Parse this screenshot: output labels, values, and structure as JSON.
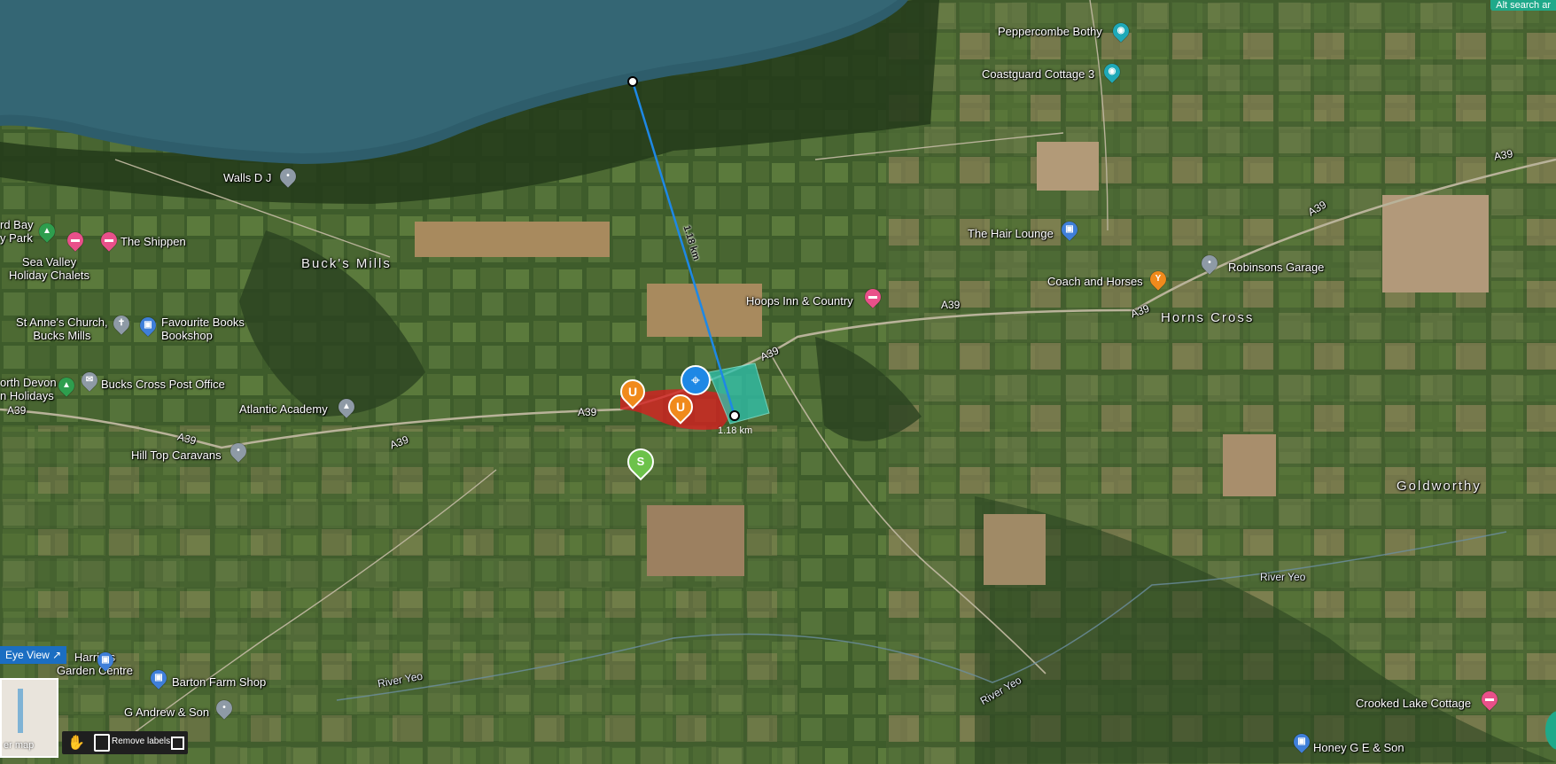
{
  "map": {
    "place_labels": [
      {
        "id": "peppercombe-bothy",
        "text": "Peppercombe Bothy",
        "icon": "camera-icon"
      },
      {
        "id": "coastguard-cottage",
        "text": "Coastguard Cottage 3",
        "icon": "camera-icon"
      },
      {
        "id": "walls-dj",
        "text": "Walls D J",
        "icon": "pin-icon"
      },
      {
        "id": "bay-park",
        "text": "rd Bay\ny Park",
        "icon": "campground-icon"
      },
      {
        "id": "the-shippen",
        "text": "The Shippen",
        "icon": "bed-icon"
      },
      {
        "id": "sea-valley",
        "text": "Sea Valley\nHoliday Chalets",
        "icon": "bed-icon"
      },
      {
        "id": "st-annes",
        "text": "St Anne's Church,\nBucks Mills",
        "icon": "cross-icon"
      },
      {
        "id": "favourite-books",
        "text": "Favourite Books\nBookshop",
        "icon": "shopping-bag-icon"
      },
      {
        "id": "north-devon",
        "text": "orth Devon\nn Holidays",
        "icon": "campground-icon"
      },
      {
        "id": "bucks-cross-po",
        "text": "Bucks Cross Post Office",
        "icon": "mail-icon"
      },
      {
        "id": "atlantic-academy",
        "text": "Atlantic Academy",
        "icon": "school-icon"
      },
      {
        "id": "hill-top",
        "text": "Hill Top Caravans",
        "icon": "pin-icon"
      },
      {
        "id": "the-hair-lounge",
        "text": "The Hair Lounge",
        "icon": "shopping-bag-icon"
      },
      {
        "id": "coach-and-horses",
        "text": "Coach and Horses",
        "icon": "bar-icon"
      },
      {
        "id": "robinsons-garage",
        "text": "Robinsons Garage",
        "icon": "pin-icon"
      },
      {
        "id": "hoops-inn",
        "text": "Hoops Inn & Country",
        "icon": "bed-icon"
      },
      {
        "id": "harriers",
        "text": "Harriers\nGarden Centre",
        "icon": "shopping-bag-icon"
      },
      {
        "id": "barton-farm",
        "text": "Barton Farm Shop",
        "icon": "shopping-bag-icon"
      },
      {
        "id": "g-andrew",
        "text": "G Andrew & Son",
        "icon": "pin-icon"
      },
      {
        "id": "crooked-lake",
        "text": "Crooked Lake Cottage",
        "icon": "bed-icon"
      },
      {
        "id": "honey-ge",
        "text": "Honey G E & Son",
        "icon": "shopping-bag-icon"
      }
    ],
    "villages": {
      "bucks_mills": "Buck's Mills",
      "horns_cross": "Horns Cross",
      "goldworthy": "Goldworthy"
    },
    "roads": {
      "a39": "A39"
    },
    "rivers": {
      "yeo": "River Yeo"
    },
    "measurement": {
      "distance": "1.18 km",
      "distance_label": "1.18 km",
      "line_color": "#1e88e5"
    },
    "markers": {
      "u": "U",
      "s": "S",
      "location": "⌖"
    },
    "colors": {
      "parcel_red": "#d42020",
      "parcel_teal": "#2ec4b0",
      "accent": "#1fa98a"
    }
  },
  "controls": {
    "search_area": "Alt search ar",
    "birds_eye": "Eye View",
    "minimap_label": "er map",
    "remove_labels": "Remove labels"
  }
}
